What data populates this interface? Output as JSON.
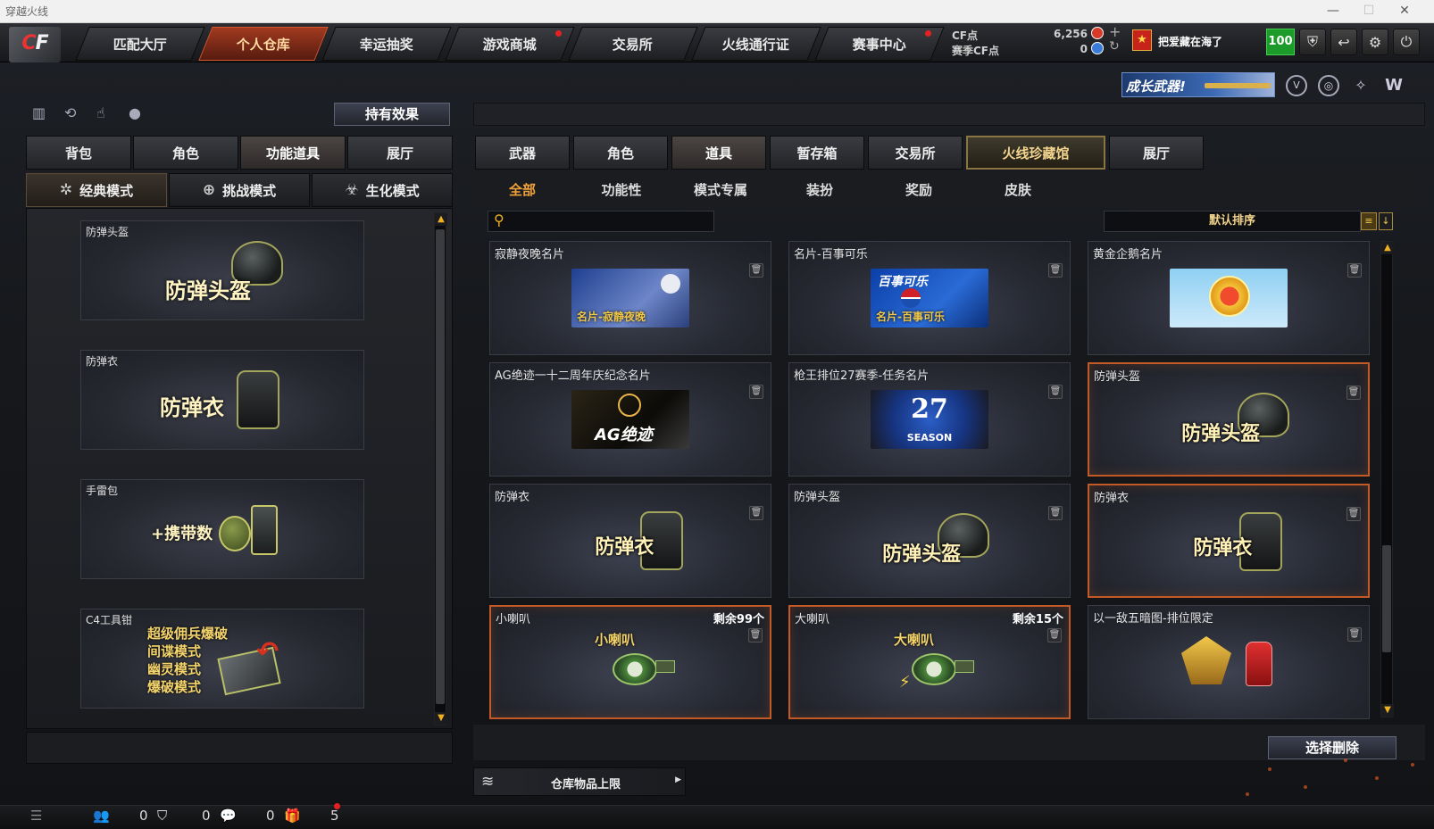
{
  "window": {
    "title": "穿越火线",
    "min": "—",
    "max": "☐",
    "close": "✕"
  },
  "logo": {
    "text": "CF"
  },
  "nav": [
    {
      "label": "匹配大厅",
      "active": false,
      "dot": false
    },
    {
      "label": "个人仓库",
      "active": true,
      "dot": false
    },
    {
      "label": "幸运抽奖",
      "active": false,
      "dot": false
    },
    {
      "label": "游戏商城",
      "active": false,
      "dot": true
    },
    {
      "label": "交易所",
      "active": false,
      "dot": false
    },
    {
      "label": "火线通行证",
      "active": false,
      "dot": false
    },
    {
      "label": "赛事中心",
      "active": false,
      "dot": true
    }
  ],
  "currency": {
    "cf_label": "CF点",
    "cf_value": "6,256",
    "season_label": "赛季CF点",
    "season_value": "0"
  },
  "user": {
    "name": "把爱藏在海了",
    "level": "100"
  },
  "banner": {
    "text": "成长武器!"
  },
  "left": {
    "effect_button": "持有效果",
    "tabs": [
      "背包",
      "角色",
      "功能道具",
      "展厅"
    ],
    "active_tab": 2,
    "modes": [
      "经典模式",
      "挑战模式",
      "生化模式"
    ],
    "active_mode": 0,
    "items": [
      {
        "name": "防弹头盔",
        "label": "防弹头盔"
      },
      {
        "name": "防弹衣",
        "label": "防弹衣"
      },
      {
        "name": "手雷包",
        "label": "+携带数"
      },
      {
        "name": "C4工具钳",
        "lines": [
          "超级佣兵爆破",
          "间谍模式",
          "幽灵模式",
          "爆破模式"
        ]
      }
    ]
  },
  "right": {
    "tabs": [
      "武器",
      "角色",
      "道具",
      "暂存箱",
      "交易所",
      "火线珍藏馆",
      "展厅"
    ],
    "active_tab": 2,
    "gold_tab": 5,
    "filters": [
      "全部",
      "功能性",
      "模式专属",
      "装扮",
      "奖励",
      "皮肤"
    ],
    "active_filter": 0,
    "search_placeholder": "",
    "sort_label": "默认排序",
    "cards": [
      {
        "name": "寂静夜晚名片",
        "caption": "名片-寂静夜晚",
        "type": "card-night",
        "remain": "",
        "hl": false
      },
      {
        "name": "名片-百事可乐",
        "caption": "名片-百事可乐",
        "type": "card-pepsi",
        "remain": "",
        "hl": false,
        "logo": "百事可乐"
      },
      {
        "name": "黄金企鹅名片",
        "caption": "",
        "type": "card-gold",
        "remain": "",
        "hl": false
      },
      {
        "name": "AG绝迹一十二周年庆纪念名片",
        "caption": "AG绝迹",
        "type": "card-ag",
        "remain": "",
        "hl": false
      },
      {
        "name": "枪王排位27赛季-任务名片",
        "caption": "27",
        "sub": "SEASON",
        "type": "card-season",
        "remain": "",
        "hl": false
      },
      {
        "name": "防弹头盔",
        "caption": "防弹头盔",
        "type": "helmet",
        "remain": "",
        "hl": true
      },
      {
        "name": "防弹衣",
        "caption": "防弹衣",
        "type": "vest",
        "remain": "",
        "hl": false
      },
      {
        "name": "防弹头盔",
        "caption": "防弹头盔",
        "type": "helmet",
        "remain": "",
        "hl": false
      },
      {
        "name": "防弹衣",
        "caption": "防弹衣",
        "type": "vest",
        "remain": "",
        "hl": true
      },
      {
        "name": "小喇叭",
        "caption": "小喇叭",
        "type": "horn",
        "remain": "剩余99个",
        "hl": true
      },
      {
        "name": "大喇叭",
        "caption": "大喇叭",
        "type": "horn2",
        "remain": "剩余15个",
        "hl": true
      },
      {
        "name": "以一敌五暗图-排位限定",
        "caption": "",
        "type": "trophy",
        "remain": "",
        "hl": false
      }
    ],
    "delete_button": "选择删除",
    "storage_limit": "仓库物品上限"
  },
  "bottom": {
    "friends": "0",
    "guild": "0",
    "chat": "0",
    "gift": "5"
  }
}
